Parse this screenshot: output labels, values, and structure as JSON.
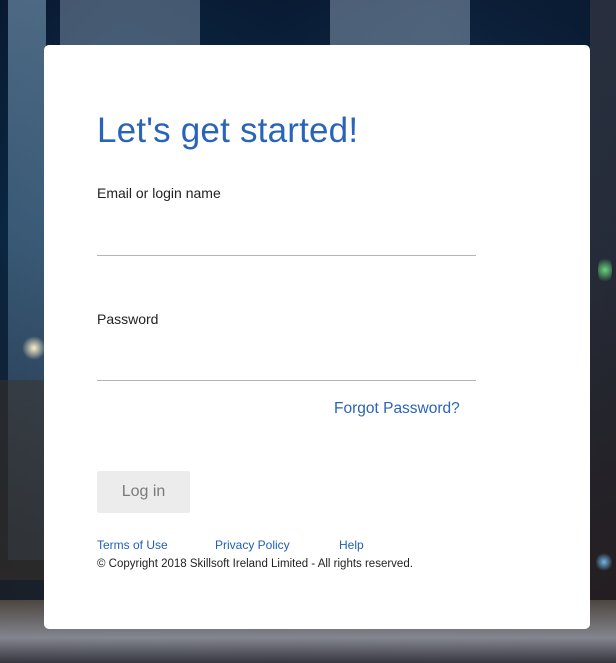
{
  "login": {
    "title": "Let's get started!",
    "email_label": "Email or login name",
    "email_value": "",
    "password_label": "Password",
    "password_value": "",
    "forgot_password": "Forgot Password?",
    "login_button": "Log in"
  },
  "footer": {
    "links": [
      {
        "label": "Terms of Use"
      },
      {
        "label": "Privacy Policy"
      },
      {
        "label": "Help"
      }
    ],
    "copyright": "© Copyright 2018 Skillsoft Ireland Limited - All rights reserved."
  },
  "colors": {
    "accent": "#2a64b8",
    "link": "#1f5fb5",
    "button_bg": "#ececec",
    "button_text": "#7a7a7a"
  }
}
